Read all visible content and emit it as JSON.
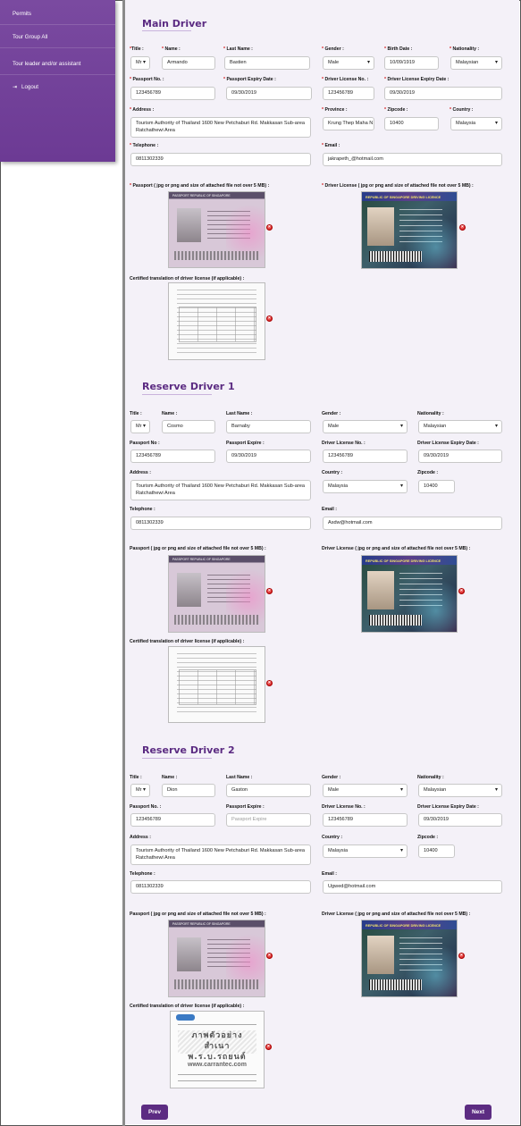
{
  "sidebar": {
    "items": [
      {
        "label": "Permits"
      },
      {
        "label": "Tour Group All"
      },
      {
        "label": "Tour leader and/or assistant"
      },
      {
        "label": "Logout",
        "icon": "logout-icon"
      }
    ]
  },
  "main_driver": {
    "title": "Main Driver",
    "labels": {
      "title": "Title :",
      "name": "Name :",
      "last_name": "Last Name :",
      "gender": "Gender :",
      "birth_date": "Birth Date :",
      "nationality": "Nationality :",
      "passport_no": "Passport No. :",
      "passport_expiry": "Passport Expiry Date :",
      "license_no": "Driver License No. :",
      "license_expiry": "Driver License Expiry Date :",
      "address": "Address :",
      "province": "Province :",
      "zipcode": "Zipcode :",
      "country": "Country :",
      "telephone": "Telephone :",
      "email": "Email :",
      "passport_upload": "Passport ( jpg or png and size of attached file not over 5 MB) :",
      "license_upload": "Driver License ( jpg or png and size of attached file not over 5 MB) :",
      "translation": "Certified translation of driver license (if applicable) :"
    },
    "values": {
      "title": "Mr",
      "name": "Armando",
      "last_name": "Bastien",
      "gender": "Male",
      "birth_date": "10/09/1919",
      "nationality": "Malaysian",
      "passport_no": "123456789",
      "passport_expiry": "09/30/2019",
      "license_no": "123456789",
      "license_expiry": "09/30/2019",
      "address": "Tourism Authority of Thailand 1600  New Petchaburi Rd. Makkasan Sub-area Ratchathewi Area",
      "province": "Krung Thep Maha N",
      "zipcode": "10400",
      "country": "Malaysia",
      "telephone": "0811302339",
      "email": "jakrapeth_@hotmail.com"
    }
  },
  "reserve_driver_1": {
    "title": "Reserve Driver 1",
    "labels": {
      "title": "Title :",
      "name": "Name :",
      "last_name": "Last Name :",
      "gender": "Gender :",
      "nationality": "Nationality :",
      "passport_no": "Passport No :",
      "passport_expiry": "Passport Expire :",
      "license_no": "Driver License No. :",
      "license_expiry": "Driver License Expiry Date :",
      "address": "Address :",
      "country": "Country :",
      "zipcode": "Zipcode :",
      "telephone": "Telephone :",
      "email": "Email :",
      "passport_upload": "Passport ( jpg or png and size of attached file not over 5 MB) :",
      "license_upload": "Driver License ( jpg or png and size of attached file not over 5 MB) :",
      "translation": "Certified translation of driver license (if applicable) :"
    },
    "values": {
      "title": "Mr",
      "name": "Cosmo",
      "last_name": "Barnaby",
      "gender": "Male",
      "nationality": "Malaysian",
      "passport_no": "123456789",
      "passport_expiry": "09/30/2019",
      "license_no": "123456789",
      "license_expiry": "09/30/2019",
      "address": "Tourism Authority of Thailand 1600  New Petchaburi Rd. Makkasan Sub-area Ratchathewi Area",
      "country": "Malaysia",
      "zipcode": "10400",
      "telephone": "0811302339",
      "email": "Asdw@hotmail.com"
    }
  },
  "reserve_driver_2": {
    "title": "Reserve Driver 2",
    "labels": {
      "title": "Title :",
      "name": "Name :",
      "last_name": "Last Name :",
      "gender": "Gender :",
      "nationality": "Nationality :",
      "passport_no": "Passport No. :",
      "passport_expiry": "Passport Expire :",
      "license_no": "Driver License No. :",
      "license_expiry": "Driver License Expiry Date :",
      "address": "Address :",
      "country": "Country :",
      "zipcode": "Zipcode :",
      "telephone": "Telephone :",
      "email": "Email :",
      "passport_upload": "Passport ( jpg or png and size of attached file not over 5 MB) :",
      "license_upload": "Driver License ( jpg or png and size of attached file not over 5 MB) :",
      "translation": "Certified translation of driver license (if applicable) :"
    },
    "values": {
      "title": "Mr",
      "name": "Dion",
      "last_name": "Gaston",
      "gender": "Male",
      "nationality": "Malaysian",
      "passport_no": "123456789",
      "passport_expiry_placeholder": "Passport Expire",
      "license_no": "123456789",
      "license_expiry": "09/30/2019",
      "address": "Tourism Authority of Thailand 1600  New Petchaburi Rd. Makkasan Sub-area Ratchathewi Area",
      "country": "Malaysia",
      "zipcode": "10400",
      "telephone": "0811302339",
      "email": "Ugwed@hotmail.com"
    }
  },
  "documents": {
    "passport_header": "PASSPORT  REPUBLIC OF SINGAPORE",
    "license_header": "REPUBLIC OF SINGAPORE  DRIVING LICENCE",
    "sample_watermark": "www.carrantec.com",
    "sample_heading": "ภาพตัวอย่าง สำเนา พ.ร.บ.รถยนต์"
  },
  "nav": {
    "prev": "Prev",
    "next": "Next"
  },
  "colors": {
    "brand": "#5c2c82",
    "sidebar": "#6c3a94",
    "required": "#d21b1b",
    "background": "#f4f1f8"
  }
}
